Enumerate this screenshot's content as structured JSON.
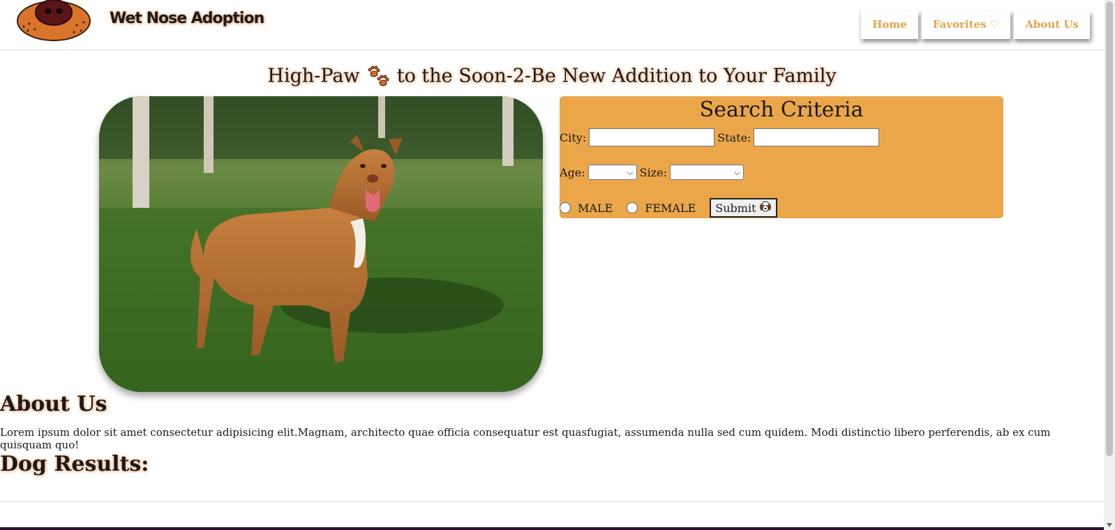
{
  "header": {
    "logo_icon": "dog-nose-logo-icon",
    "brand_name": "Wet Nose Adoption",
    "nav": [
      {
        "label": "Home"
      },
      {
        "label": "Favorites ♡"
      },
      {
        "label": "About Us"
      }
    ],
    "accent_color": "#e8a34c"
  },
  "hero": {
    "title_before": "High-Paw",
    "title_icon": "paw-prints-icon",
    "title_after": "to the Soon-2-Be New Addition to Your Family",
    "photo": "brown-pitbull-on-grass-photo"
  },
  "search": {
    "title": "Search Criteria",
    "city_label": "City:",
    "city_value": "",
    "state_label": "State:",
    "state_value": "",
    "age_label": "Age:",
    "age_value": "",
    "size_label": "Size:",
    "size_value": "",
    "male_label": "MALE",
    "female_label": "FEMALE",
    "submit_label": "Submit",
    "submit_icon": "dog-face-icon",
    "panel_color": "#eba64a"
  },
  "about": {
    "heading": "About Us",
    "body": "Lorem ipsum dolor sit amet consectetur adipisicing elit.Magnam, architecto quae officia consequatur est quasfugiat, assumenda nulla sed cum quidem. Modi distinctio libero perferendis, ab ex cum quisquam quo!"
  },
  "results": {
    "heading": "Dog Results:"
  }
}
